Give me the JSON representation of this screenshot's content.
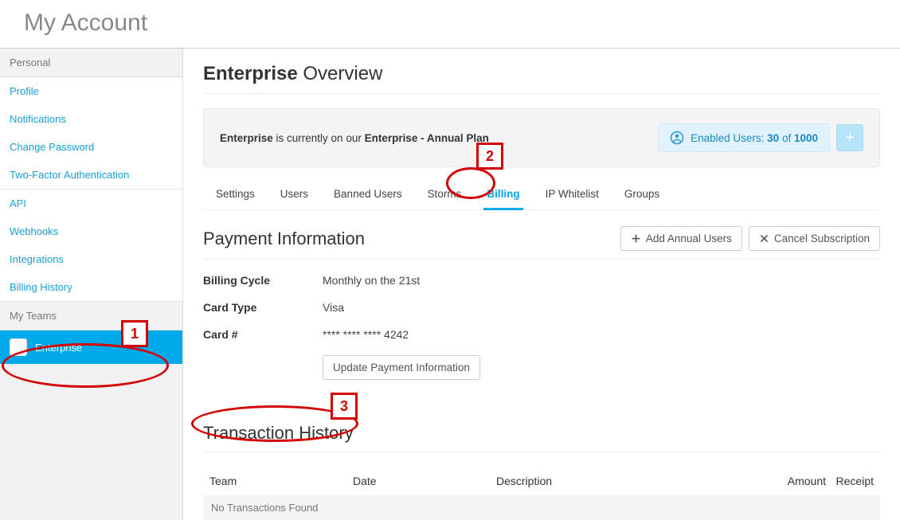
{
  "page_title": "My Account",
  "sidebar": {
    "section1": "Personal",
    "items1": [
      "Profile",
      "Notifications",
      "Change Password",
      "Two-Factor Authentication"
    ],
    "items2": [
      "API",
      "Webhooks",
      "Integrations",
      "Billing History"
    ],
    "section2": "My Teams",
    "team_name": "Enterprise"
  },
  "overview": {
    "title_bold": "Enterprise",
    "title_rest": " Overview",
    "plan_team": "Enterprise",
    "plan_mid": " is currently on our ",
    "plan_name": "Enterprise - Annual Plan",
    "enabled_users_prefix": "Enabled Users: ",
    "enabled_users_count": "30",
    "enabled_users_of": " of ",
    "enabled_users_total": "1000"
  },
  "tabs": [
    "Settings",
    "Users",
    "Banned Users",
    "Storms",
    "Billing",
    "IP Whitelist",
    "Groups"
  ],
  "active_tab": "Billing",
  "payment": {
    "section_title": "Payment Information",
    "add_users_btn": "Add Annual Users",
    "cancel_btn": "Cancel Subscription",
    "rows": [
      {
        "label": "Billing Cycle",
        "value": "Monthly on the 21st"
      },
      {
        "label": "Card Type",
        "value": "Visa"
      },
      {
        "label": "Card #",
        "value": "**** **** **** 4242"
      }
    ],
    "update_btn": "Update Payment Information"
  },
  "transactions": {
    "section_title": "Transaction History",
    "columns": {
      "team": "Team",
      "date": "Date",
      "desc": "Description",
      "amount": "Amount",
      "receipt": "Receipt"
    },
    "empty": "No Transactions Found"
  },
  "annotations": {
    "n1": "1",
    "n2": "2",
    "n3": "3"
  }
}
